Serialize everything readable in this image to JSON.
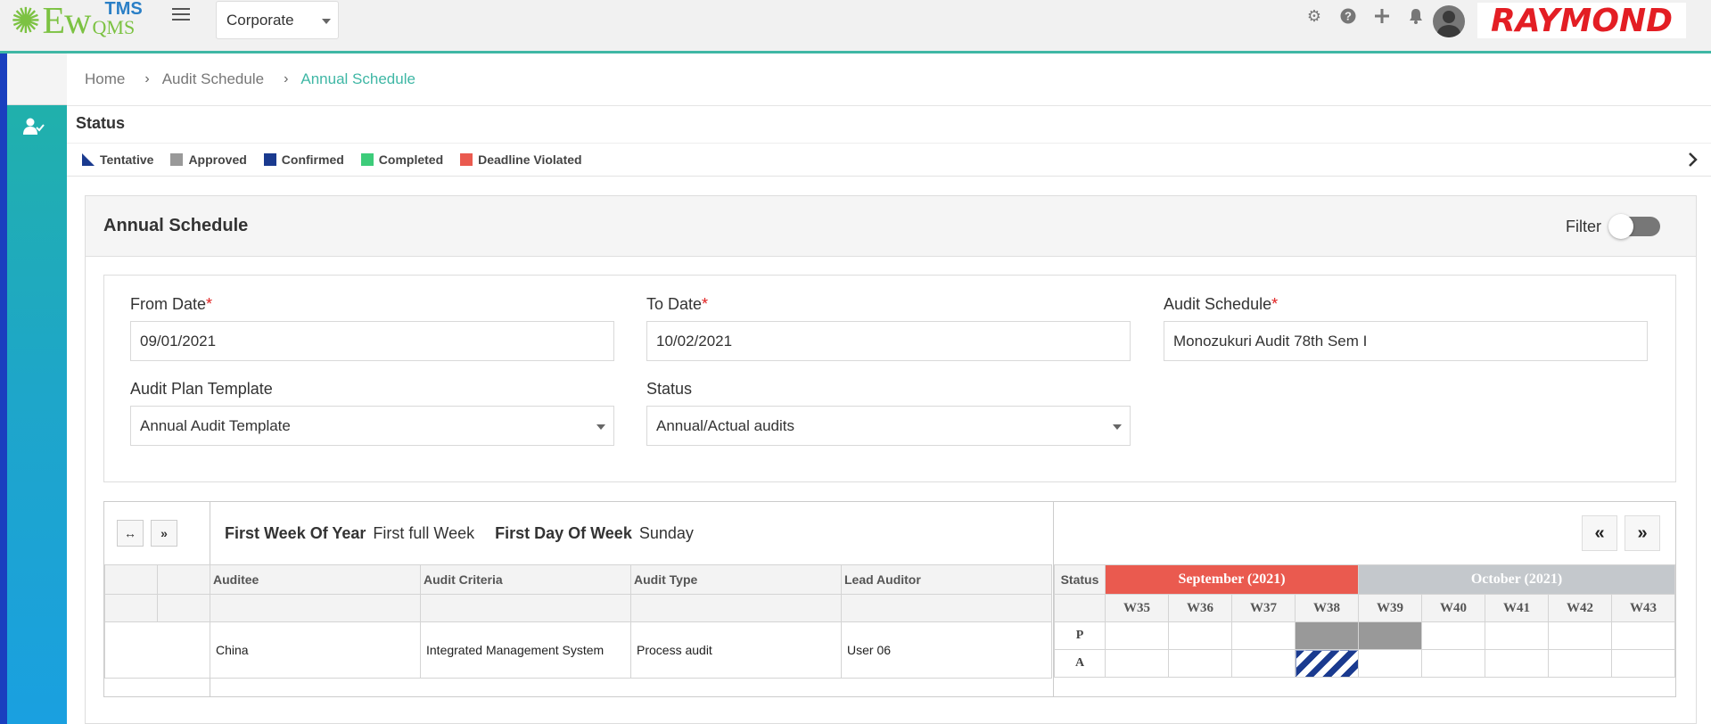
{
  "header": {
    "logo": {
      "ew": "Ew",
      "tms": "TMS",
      "qms": "QMS"
    },
    "org_select": "Corporate",
    "icons": [
      "gear-icon",
      "help-icon",
      "plus-icon",
      "bell-icon"
    ],
    "brand": "RAYMOND"
  },
  "breadcrumb": {
    "home": "Home",
    "parent": "Audit Schedule",
    "current": "Annual Schedule"
  },
  "status": {
    "title": "Status",
    "legend": [
      {
        "label": "Tentative",
        "color": "#1a3a8f"
      },
      {
        "label": "Approved",
        "color": "#999999"
      },
      {
        "label": "Confirmed",
        "color": "#1a3a8f"
      },
      {
        "label": "Completed",
        "color": "#3dcc7a"
      },
      {
        "label": "Deadline Violated",
        "color": "#ea5a4f"
      }
    ]
  },
  "panel": {
    "title": "Annual Schedule",
    "filter_label": "Filter"
  },
  "form": {
    "from_date": {
      "label": "From Date",
      "value": "09/01/2021"
    },
    "to_date": {
      "label": "To Date",
      "value": "10/02/2021"
    },
    "audit_schedule": {
      "label": "Audit Schedule",
      "value": "Monozukuri Audit 78th Sem I"
    },
    "template": {
      "label": "Audit Plan Template",
      "value": "Annual Audit Template"
    },
    "status": {
      "label": "Status",
      "value": "Annual/Actual audits"
    },
    "required_mark": "*"
  },
  "schedule": {
    "first_week_label": "First Week Of Year",
    "first_week_value": "First full Week",
    "first_day_label": "First Day Of Week",
    "first_day_value": "Sunday",
    "columns": [
      "Auditee",
      "Audit Criteria",
      "Audit Type",
      "Lead Auditor"
    ],
    "rows": [
      {
        "auditee": "China",
        "criteria": "Integrated Management System",
        "type": "Process audit",
        "lead": "User 06"
      }
    ],
    "status_header": "Status",
    "months": [
      {
        "label": "September (2021)",
        "color": "#ea5a4f"
      },
      {
        "label": "October (2021)",
        "color": "#c4c8cc"
      }
    ],
    "weeks": [
      "W35",
      "W36",
      "W37",
      "W38",
      "W39",
      "W40",
      "W41",
      "W42",
      "W43"
    ],
    "plan_label": "P",
    "actual_label": "A",
    "plan_weeks": [
      "W38",
      "W39"
    ],
    "actual_weeks": [
      "W38"
    ]
  }
}
